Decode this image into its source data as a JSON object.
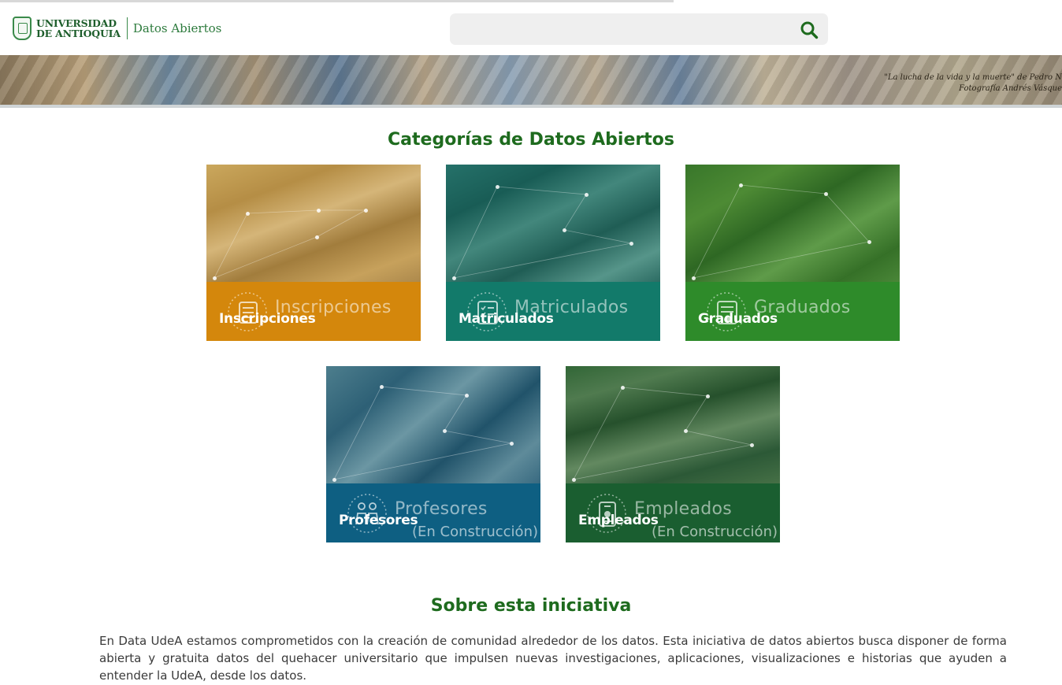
{
  "header": {
    "logo_university": "UNIVERSIDAD DE ANTIOQUIA",
    "logo_line1": "UNIVERSIDAD",
    "logo_line2": "DE ANTIOQUIA",
    "logo_product": "Datos Abiertos",
    "search": {
      "placeholder": "",
      "icon": "search-icon"
    }
  },
  "banner": {
    "caption_line1": "\"La lucha de la vida y la muerte\" de Pedro N",
    "caption_line2": "Fotografía Andrés Vásque"
  },
  "categories": {
    "title": "Categorías de Datos Abiertos",
    "items": [
      {
        "label": "Inscripciones",
        "overlay": "Inscripciones",
        "status": "",
        "color": "#d4870c",
        "icon": "form-icon"
      },
      {
        "label": "Matriculados",
        "overlay": "Matriculados",
        "status": "",
        "color": "#127a6a",
        "icon": "checklist-icon"
      },
      {
        "label": "Graduados",
        "overlay": "Graduados",
        "status": "",
        "color": "#2e8b2a",
        "icon": "diploma-icon"
      },
      {
        "label": "Profesores",
        "overlay": "Profesores",
        "status": "(En Construcción)",
        "color": "#0e5f82",
        "icon": "teachers-icon"
      },
      {
        "label": "Empleados",
        "overlay": "Empleados",
        "status": "(En Construcción)",
        "color": "#1a5e30",
        "icon": "badge-icon"
      }
    ]
  },
  "about": {
    "title": "Sobre esta iniciativa",
    "text": "En Data UdeA estamos comprometidos con la creación de comunidad alrededor de los datos. Esta iniciativa de datos abiertos busca disponer de forma abierta y gratuita datos del quehacer universitario que impulsen nuevas investigaciones, aplicaciones, visualizaciones e historias que ayuden a entender la UdeA, desde los datos."
  },
  "colors": {
    "title_green": "#1e6b1e",
    "search_bg": "#efefef",
    "search_icon": "#1e6b1e"
  }
}
